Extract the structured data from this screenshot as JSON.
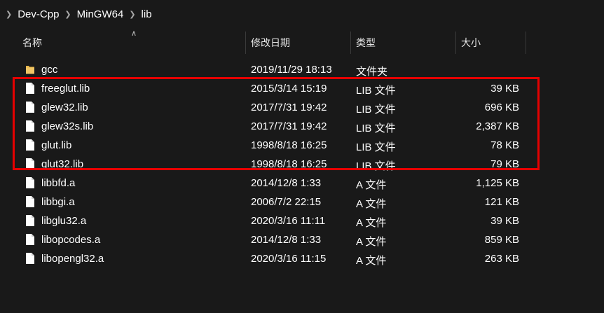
{
  "breadcrumb": {
    "items": [
      "Dev-Cpp",
      "MinGW64",
      "lib"
    ]
  },
  "columns": {
    "name": "名称",
    "modified": "修改日期",
    "type": "类型",
    "size": "大小"
  },
  "files": [
    {
      "name": "gcc",
      "modified": "2019/11/29 18:13",
      "type": "文件夹",
      "size": "",
      "icon": "folder-icon"
    },
    {
      "name": "freeglut.lib",
      "modified": "2015/3/14 15:19",
      "type": "LIB 文件",
      "size": "39 KB",
      "icon": "file-icon"
    },
    {
      "name": "glew32.lib",
      "modified": "2017/7/31 19:42",
      "type": "LIB 文件",
      "size": "696 KB",
      "icon": "file-icon"
    },
    {
      "name": "glew32s.lib",
      "modified": "2017/7/31 19:42",
      "type": "LIB 文件",
      "size": "2,387 KB",
      "icon": "file-icon"
    },
    {
      "name": "glut.lib",
      "modified": "1998/8/18 16:25",
      "type": "LIB 文件",
      "size": "78 KB",
      "icon": "file-icon"
    },
    {
      "name": "glut32.lib",
      "modified": "1998/8/18 16:25",
      "type": "LIB 文件",
      "size": "79 KB",
      "icon": "file-icon"
    },
    {
      "name": "libbfd.a",
      "modified": "2014/12/8 1:33",
      "type": "A 文件",
      "size": "1,125 KB",
      "icon": "file-icon"
    },
    {
      "name": "libbgi.a",
      "modified": "2006/7/2 22:15",
      "type": "A 文件",
      "size": "121 KB",
      "icon": "file-icon"
    },
    {
      "name": "libglu32.a",
      "modified": "2020/3/16 11:11",
      "type": "A 文件",
      "size": "39 KB",
      "icon": "file-icon"
    },
    {
      "name": "libopcodes.a",
      "modified": "2014/12/8 1:33",
      "type": "A 文件",
      "size": "859 KB",
      "icon": "file-icon"
    },
    {
      "name": "libopengl32.a",
      "modified": "2020/3/16 11:15",
      "type": "A 文件",
      "size": "263 KB",
      "icon": "file-icon"
    }
  ],
  "colors": {
    "background": "#191919",
    "highlight_border": "#e60000",
    "folder": "#e8b64c",
    "file": "#ffffff"
  }
}
